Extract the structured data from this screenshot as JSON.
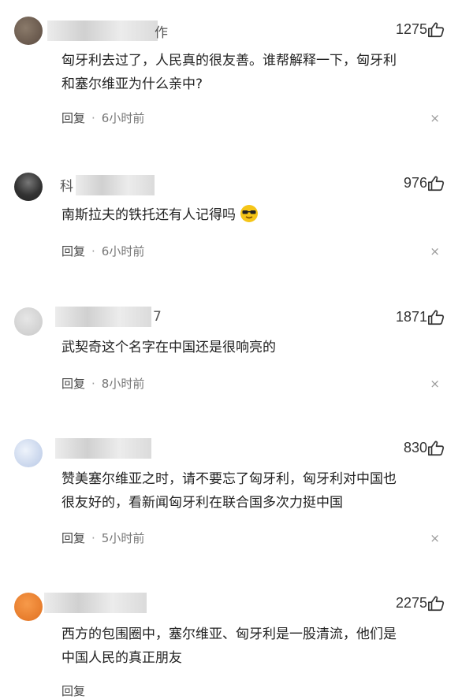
{
  "comments": [
    {
      "name_visible": "作",
      "likes": "1275",
      "text_line1": "匈牙利去过了，人民真的很友善。谁帮解释一下，匈牙利",
      "text_line2": "和塞尔维亚为什么亲中?",
      "reply": "回复",
      "dot": "·",
      "time": "6小时前",
      "close": "×"
    },
    {
      "name_visible": "科",
      "likes": "976",
      "text_line1": "南斯拉夫的铁托还有人记得吗",
      "reply": "回复",
      "dot": "·",
      "time": "6小时前",
      "close": "×"
    },
    {
      "name_visible": "7",
      "likes": "1871",
      "text_line1": "武契奇这个名字在中国还是很响亮的",
      "reply": "回复",
      "dot": "·",
      "time": "8小时前",
      "close": "×"
    },
    {
      "name_visible": "",
      "likes": "830",
      "text_line1": "赞美塞尔维亚之时，请不要忘了匈牙利，匈牙利对中国也",
      "text_line2": "很友好的，看新闻匈牙利在联合国多次力挺中国",
      "reply": "回复",
      "dot": "·",
      "time": "5小时前",
      "close": "×"
    },
    {
      "name_visible": "",
      "likes": "2275",
      "text_line1": "西方的包围圈中，塞尔维亚、匈牙利是一股清流，他们是",
      "text_line2": "中国人民的真正朋友",
      "reply": "回复",
      "dot": "·",
      "time": "",
      "close": ""
    }
  ],
  "colors": {
    "text": "#222222",
    "meta": "#777777",
    "emoji": "#f5c518"
  },
  "icons": [
    "thumbs-up-icon",
    "close-icon",
    "sunglasses-emoji-icon"
  ]
}
